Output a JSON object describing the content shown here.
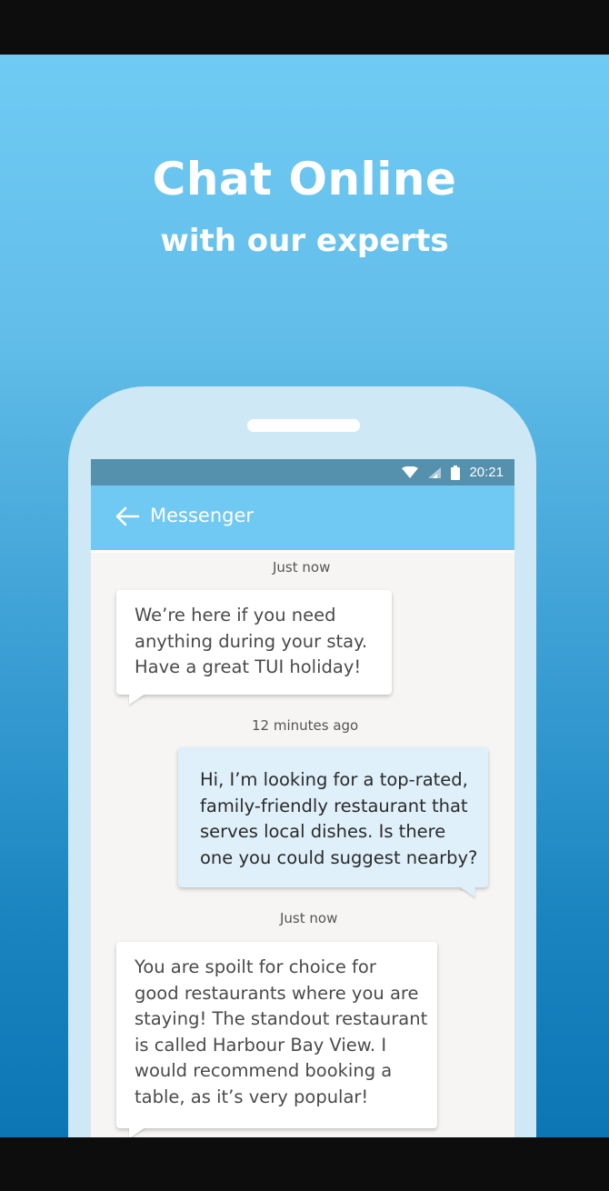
{
  "promo": {
    "headline": "Chat Online",
    "subhead": "with our experts"
  },
  "status_bar": {
    "time": "20:21",
    "icons": [
      "wifi-icon",
      "signal-icon",
      "battery-icon"
    ]
  },
  "app_bar": {
    "title": "Messenger",
    "back_icon": "arrow-left-icon"
  },
  "messages": [
    {
      "timestamp": "Just now",
      "direction": "incoming",
      "lines": [
        "We’re here if you need",
        "anything during your stay.",
        "Have a great TUI holiday!"
      ]
    },
    {
      "timestamp": "12 minutes ago",
      "direction": "outgoing",
      "lines": [
        "Hi, I’m looking for a top-rated,",
        "family-friendly restaurant that",
        "serves local dishes. Is there",
        "one you could suggest nearby?"
      ]
    },
    {
      "timestamp": "Just now",
      "direction": "incoming",
      "lines": [
        "You are spoilt for choice for",
        "good restaurants where you are",
        "staying! The standout restaurant",
        "is called Harbour Bay View. I",
        "would recommend booking a",
        "table, as it’s very popular!"
      ]
    }
  ],
  "colors": {
    "app_bar": "#6fc9f3",
    "status_bar": "#5590ac",
    "outgoing_bubble": "#dff0fb",
    "incoming_bubble": "#ffffff"
  }
}
